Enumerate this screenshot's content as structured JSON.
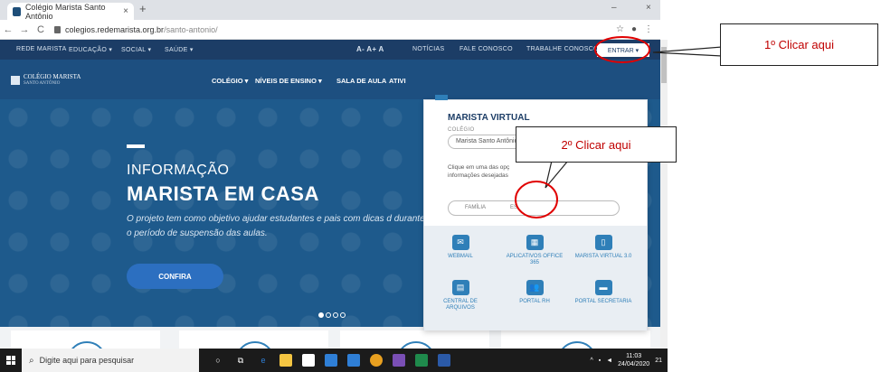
{
  "browser": {
    "tab_title": "Colégio Marista Santo Antônio",
    "tab_close": "×",
    "new_tab": "+",
    "url_domain": "colegios.redemarista.org.br",
    "url_path": "/santo-antonio/",
    "back": "←",
    "forward": "→",
    "reload": "C",
    "minimize": "–",
    "close": "×"
  },
  "topnav": {
    "items": [
      "REDE MARISTA",
      "EDUCAÇÃO ▾",
      "SOCIAL ▾",
      "SAÚDE ▾"
    ],
    "font_controls": "A- A+ A",
    "links": [
      "NOTÍCIAS",
      "FALE CONOSCO",
      "TRABALHE CONOSCO"
    ],
    "entrar": "ENTRAR ▾"
  },
  "mainbar": {
    "logo_title": "COLÉGIO MARISTA",
    "logo_sub": "SANTO ANTÔNIO",
    "nav": [
      "COLÉGIO ▾",
      "NÍVEIS DE ENSINO ▾",
      "SALA DE AULA",
      "ATIVI"
    ]
  },
  "hero": {
    "kicker": "INFORMAÇÃO",
    "title": "MARISTA EM CASA",
    "desc": "O projeto tem como objetivo ajudar estudantes e pais com dicas d durante o período de suspensão das aulas.",
    "button": "CONFIRA"
  },
  "dropdown": {
    "title": "MARISTA VIRTUAL",
    "label": "COLÉGIO",
    "select_value": "Marista Santo Antônio",
    "help": "Clique em uma das opç informações desejadas",
    "toggle": [
      "FAMÍLIA",
      "ES"
    ],
    "tiles": [
      {
        "icon": "✉",
        "label": "WEBMAIL"
      },
      {
        "icon": "▦",
        "label": "APLICATIVOS OFFICE 365"
      },
      {
        "icon": "▯",
        "label": "MARISTA VIRTUAL 3.0"
      },
      {
        "icon": "▤",
        "label": "CENTRAL DE ARQUIVOS"
      },
      {
        "icon": "👥",
        "label": "PORTAL RH"
      },
      {
        "icon": "▬",
        "label": "PORTAL SECRETARIA"
      }
    ]
  },
  "annotations": {
    "first": "1º Clicar aqui",
    "second": "2º Clicar aqui"
  },
  "taskbar": {
    "search_placeholder": "Digite aqui para pesquisar",
    "time": "11:03",
    "date": "24/04/2020",
    "notifications": "21"
  },
  "colors": {
    "navy": "#1c3d66",
    "hero": "#1e5a8c",
    "accent": "#2f7fb8",
    "annotation_red": "#c00000"
  }
}
